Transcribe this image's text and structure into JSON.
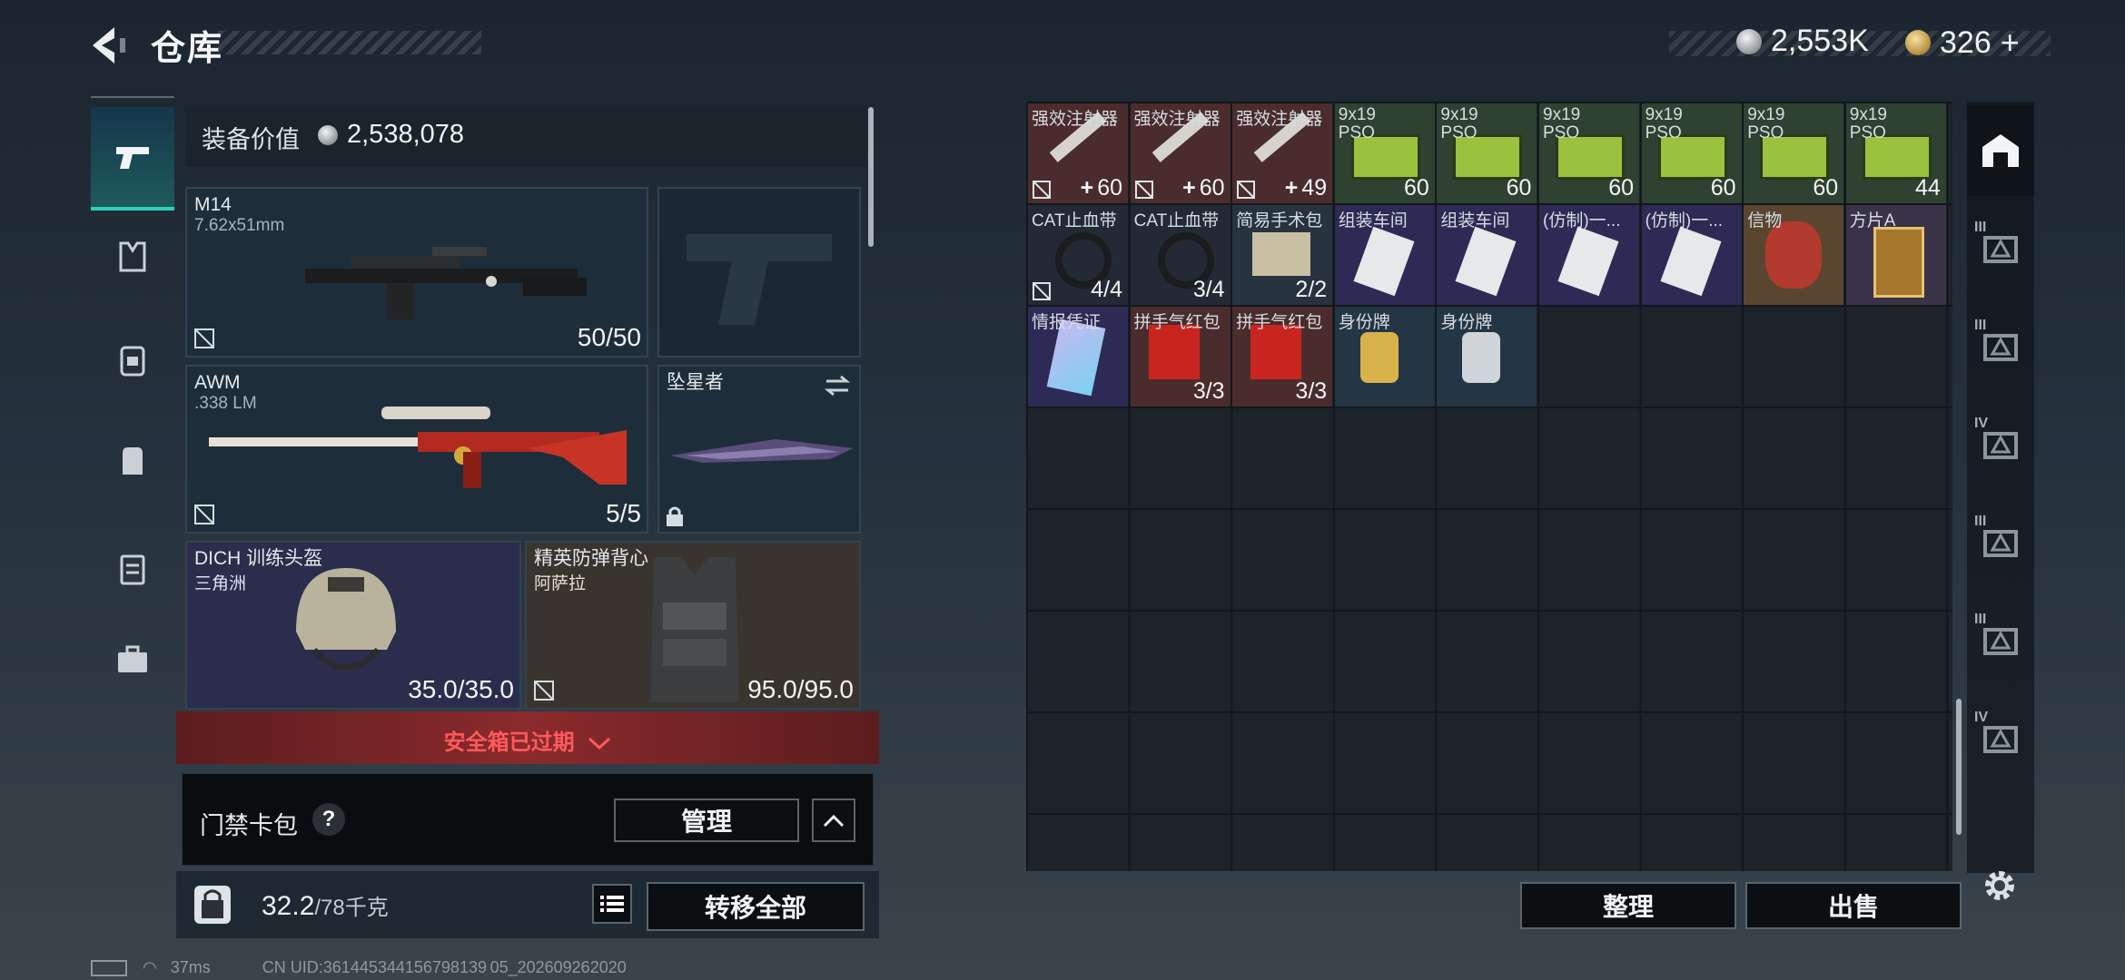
{
  "header": {
    "title": "仓库",
    "back_num": "1"
  },
  "currency": {
    "silver": "2,553K",
    "gold": "326",
    "gold_add": "+"
  },
  "nav": {
    "items": [
      "weapon",
      "armor",
      "backpack",
      "bag",
      "rig",
      "case"
    ]
  },
  "equipment": {
    "value_label": "装备价值",
    "value": "2,538,078",
    "primary": {
      "name": "M14",
      "ammo": "7.62x51mm",
      "count": "50/50"
    },
    "pistol": {
      "name": ""
    },
    "secondary": {
      "name": "AWM",
      "ammo": ".338 LM",
      "count": "5/5"
    },
    "melee": {
      "name": "坠星者"
    },
    "helmet": {
      "name": "DICH 训练头盔",
      "sub": "三角洲",
      "count": "35.0/35.0"
    },
    "armor": {
      "name": "精英防弹背心",
      "sub": "阿萨拉",
      "count": "95.0/95.0"
    }
  },
  "safe_box": {
    "text": "安全箱已过期"
  },
  "keycard": {
    "label": "门禁卡包",
    "help": "?",
    "manage": "管理"
  },
  "weight": {
    "current": "32.2",
    "max": "/78千克",
    "transfer_all": "转移全部"
  },
  "inventory": {
    "row1": [
      {
        "name": "强效注射器",
        "count": "60",
        "plus": "+"
      },
      {
        "name": "强效注射器",
        "count": "60",
        "plus": "+"
      },
      {
        "name": "强效注射器",
        "count": "49",
        "plus": "+"
      },
      {
        "name": "9x19",
        "sub": "PSO",
        "count": "60"
      },
      {
        "name": "9x19",
        "sub": "PSO",
        "count": "60"
      },
      {
        "name": "9x19",
        "sub": "PSO",
        "count": "60"
      },
      {
        "name": "9x19",
        "sub": "PSO",
        "count": "60"
      },
      {
        "name": "9x19",
        "sub": "PSO",
        "count": "60"
      },
      {
        "name": "9x19",
        "sub": "PSO",
        "count": "44"
      }
    ],
    "row2": [
      {
        "name": "CAT止血带",
        "count": "4/4"
      },
      {
        "name": "CAT止血带",
        "count": "3/4"
      },
      {
        "name": "简易手术包",
        "count": "2/2"
      },
      {
        "name": "组装车间",
        "count": ""
      },
      {
        "name": "组装车间",
        "count": ""
      },
      {
        "name": "(仿制)一...",
        "count": ""
      },
      {
        "name": "(仿制)一...",
        "count": ""
      },
      {
        "name": "信物",
        "count": ""
      },
      {
        "name": "方片A",
        "count": ""
      }
    ],
    "row3": [
      {
        "name": "情报凭证",
        "count": ""
      },
      {
        "name": "拼手气红包",
        "count": "3/3"
      },
      {
        "name": "拼手气红包",
        "count": "3/3"
      },
      {
        "name": "身份牌",
        "count": ""
      },
      {
        "name": "身份牌",
        "count": ""
      }
    ],
    "sort": "整理",
    "sell": "出售"
  },
  "side_tabs": [
    "III",
    "III",
    "IV",
    "III",
    "III",
    "IV"
  ],
  "status": {
    "ping": "37ms",
    "uid": "CN UID:361445344156798139 05_202609262020"
  },
  "colors": {
    "accent": "#2fd1b8",
    "danger": "#ff5a5a",
    "rarity_purple": "#2d2a55",
    "rarity_gold": "#5a4630",
    "rarity_red": "#4a2c2d",
    "rarity_green": "#2f4232"
  }
}
